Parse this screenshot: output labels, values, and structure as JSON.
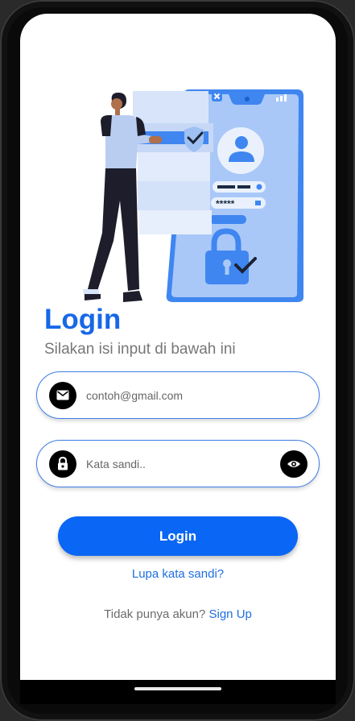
{
  "login": {
    "title": "Login",
    "subtitle": "Silakan isi input di bawah ini",
    "email": {
      "placeholder": "contoh@gmail.com",
      "value": ""
    },
    "password": {
      "placeholder": "Kata sandi..",
      "value": ""
    },
    "login_button": "Login",
    "forgot_password": "Lupa kata sandi?",
    "signup_prompt": "Tidak punya akun?",
    "signup_link": "Sign Up"
  },
  "illustration": {
    "password_mask": "*****"
  },
  "colors": {
    "accent": "#0a66f5",
    "title": "#1768e8",
    "field_border": "#3d7de6",
    "link": "#1e6fe0"
  },
  "icons": [
    "camera-icon",
    "mail-icon",
    "lock-icon",
    "eye-icon"
  ]
}
